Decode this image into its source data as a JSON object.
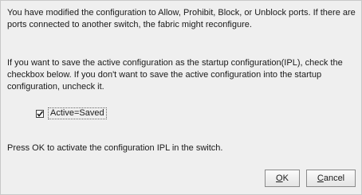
{
  "dialog": {
    "message_1": "You have modified the configuration to Allow, Prohibit, Block, or Unblock ports. If there are ports connected to another switch, the fabric might reconfigure.",
    "message_2": "If you want to save the active configuration as the startup configuration(IPL), check the checkbox below. If you don't want to save the active configuration into the startup configuration, uncheck it.",
    "message_3": "Press OK to activate the configuration IPL in the switch.",
    "checkbox": {
      "label": "Active=Saved",
      "checked": true
    },
    "buttons": {
      "ok_mnemonic": "O",
      "ok_rest": "K",
      "cancel_mnemonic": "C",
      "cancel_rest": "ancel"
    }
  }
}
